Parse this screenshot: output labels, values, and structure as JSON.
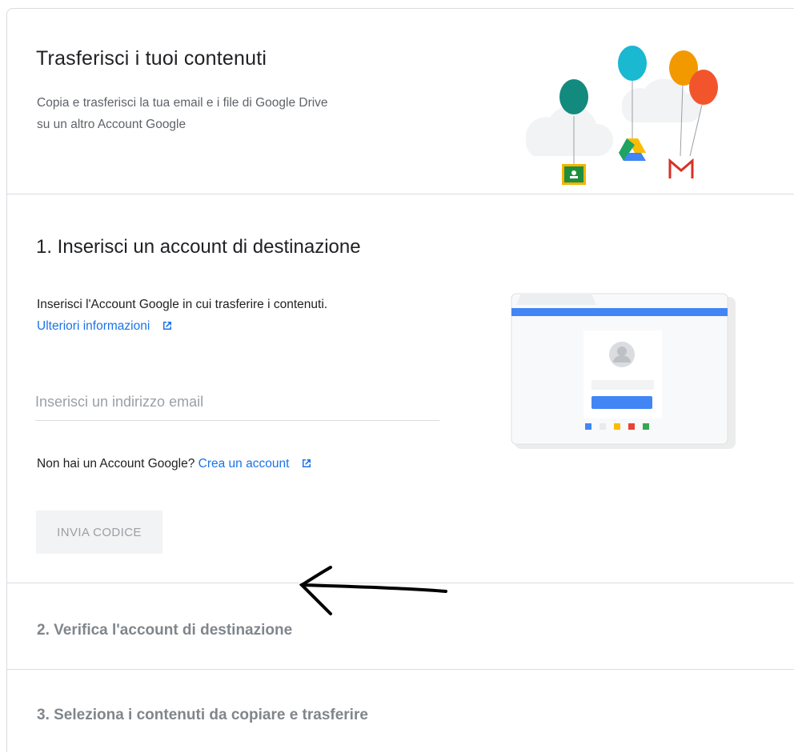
{
  "header": {
    "title": "Trasferisci i tuoi contenuti",
    "subtitle_line1": "Copia e trasferisci la tua email e i file di Google Drive",
    "subtitle_line2": "su un altro Account Google"
  },
  "step1": {
    "title": "1. Inserisci un account di destinazione",
    "description": "Inserisci l'Account Google in cui trasferire i contenuti.",
    "more_info_link": "Ulteriori informazioni",
    "email_placeholder": "Inserisci un indirizzo email",
    "email_value": "",
    "no_account_text": "Non hai un Account Google?",
    "create_account_link": "Crea un account",
    "send_code_button": "INVIA CODICE"
  },
  "step2": {
    "title": "2. Verifica l'account di destinazione"
  },
  "step3": {
    "title": "3. Seleziona i contenuti da copiare e trasferire"
  },
  "colors": {
    "link": "#1a73e8",
    "google_blue": "#4285f4",
    "google_red": "#ea4335",
    "google_yellow": "#fbbc04",
    "google_green": "#34a853"
  }
}
